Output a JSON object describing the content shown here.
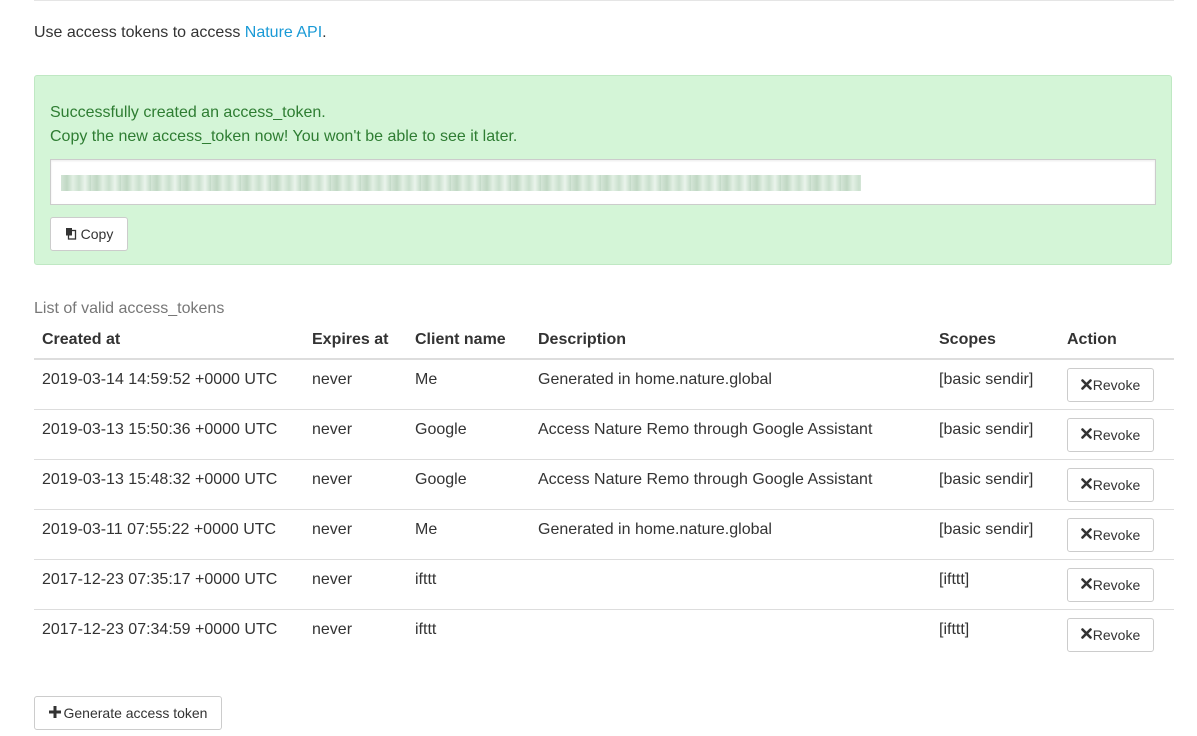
{
  "intro": {
    "text": "Use access tokens to access ",
    "link": "Nature API",
    "period": "."
  },
  "alert": {
    "line1": "Successfully created an access_token.",
    "line2": "Copy the new access_token now! You won't be able to see it later.",
    "copy_label": "Copy",
    "copy_icon": "clipboard-icon"
  },
  "list": {
    "caption": "List of valid access_tokens",
    "headers": {
      "created": "Created at",
      "expires": "Expires at",
      "client": "Client name",
      "description": "Description",
      "scopes": "Scopes",
      "action": "Action"
    },
    "revoke_label": "Revoke",
    "revoke_icon": "times-icon",
    "rows": [
      {
        "created": "2019-03-14 14:59:52 +0000 UTC",
        "expires": "never",
        "client": "Me",
        "description": "Generated in home.nature.global",
        "scopes": "[basic sendir]"
      },
      {
        "created": "2019-03-13 15:50:36 +0000 UTC",
        "expires": "never",
        "client": "Google",
        "description": "Access Nature Remo through Google Assistant",
        "scopes": "[basic sendir]"
      },
      {
        "created": "2019-03-13 15:48:32 +0000 UTC",
        "expires": "never",
        "client": "Google",
        "description": "Access Nature Remo through Google Assistant",
        "scopes": "[basic sendir]"
      },
      {
        "created": "2019-03-11 07:55:22 +0000 UTC",
        "expires": "never",
        "client": "Me",
        "description": "Generated in home.nature.global",
        "scopes": "[basic sendir]"
      },
      {
        "created": "2017-12-23 07:35:17 +0000 UTC",
        "expires": "never",
        "client": "ifttt",
        "description": "",
        "scopes": "[ifttt]"
      },
      {
        "created": "2017-12-23 07:34:59 +0000 UTC",
        "expires": "never",
        "client": "ifttt",
        "description": "",
        "scopes": "[ifttt]"
      }
    ]
  },
  "generate": {
    "label": "Generate access token",
    "icon": "plus-icon"
  },
  "colors": {
    "link": "#1a9ad6",
    "alert_bg": "#d4f5d7",
    "alert_text": "#2e7d32"
  }
}
